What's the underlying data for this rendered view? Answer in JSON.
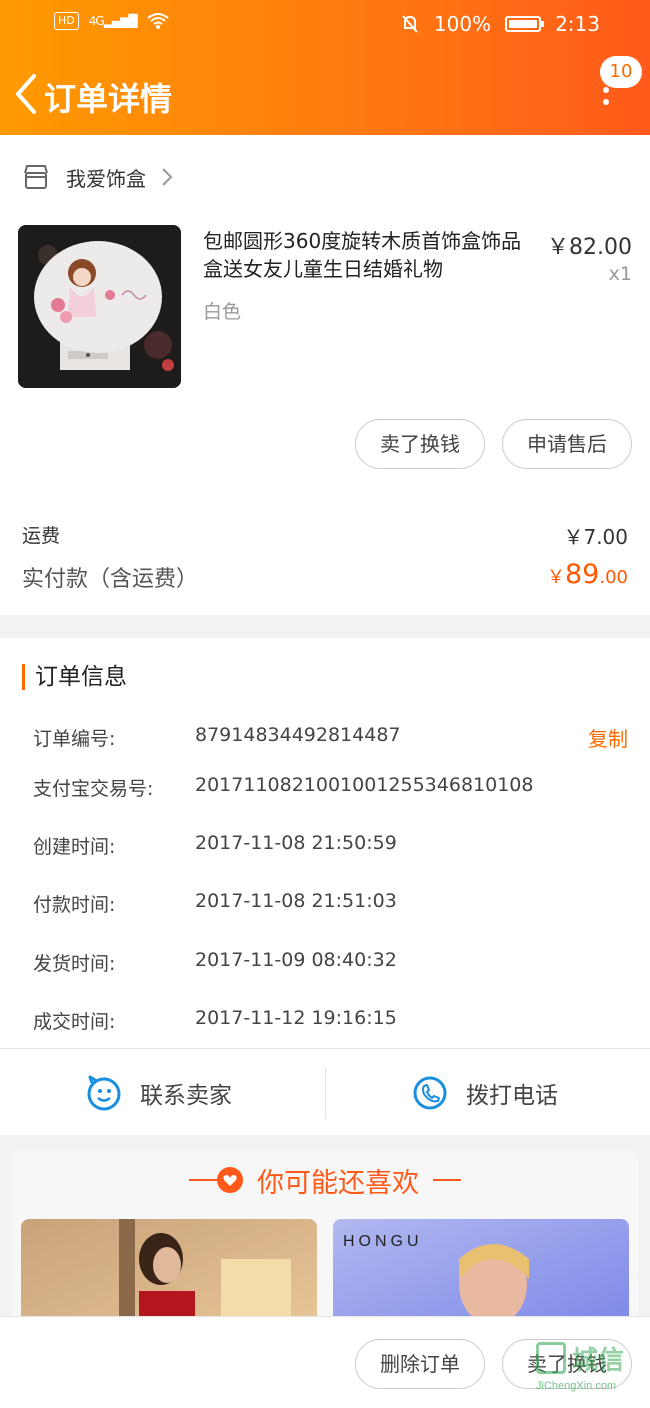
{
  "status_bar": {
    "hd": "HD",
    "network": "4G",
    "battery_percent": "100%",
    "battery_level": 1.0,
    "time": "2:13"
  },
  "nav": {
    "title": "订单详情",
    "notification_count": "10"
  },
  "shop": {
    "name": "我爱饰盒"
  },
  "product": {
    "title": "包邮圆形360度旋转木质首饰盒饰品盒送女友儿童生日结婚礼物",
    "variant": "白色",
    "price": "￥82.00",
    "quantity": "x1"
  },
  "item_actions": {
    "sell_label": "卖了换钱",
    "after_sale_label": "申请售后"
  },
  "summary": {
    "shipping_label": "运费",
    "shipping_value": "￥7.00",
    "paid_label": "实付款（含运费）",
    "paid_currency": "￥",
    "paid_integer": "89",
    "paid_decimal": ".00"
  },
  "order_info": {
    "section_title": "订单信息",
    "copy_label": "复制",
    "rows": [
      {
        "key": "订单编号:",
        "value": "87914834492814487"
      },
      {
        "key": "支付宝交易号:",
        "value": "20171108210010012553468101​08"
      },
      {
        "key": "创建时间:",
        "value": "2017-11-08 21:50:59"
      },
      {
        "key": "付款时间:",
        "value": "2017-11-08 21:51:03"
      },
      {
        "key": "发货时间:",
        "value": "2017-11-09 08:40:32"
      },
      {
        "key": "成交时间:",
        "value": "2017-11-12 19:16:15"
      }
    ]
  },
  "contact": {
    "seller_label": "联系卖家",
    "call_label": "拨打电话"
  },
  "recommend": {
    "title": "你可能还喜欢",
    "cards": [
      {
        "brand": ""
      },
      {
        "brand": "HONGU"
      }
    ]
  },
  "bottom_actions": {
    "delete_label": "删除订单",
    "sell_label": "卖了换钱"
  },
  "watermark": {
    "text": "城信",
    "url": "JiChengXin.com"
  },
  "colors": {
    "accent": "#ff6a00",
    "header_start": "#ff9a00",
    "header_end": "#ff5a1a",
    "link_blue": "#1a8fe0"
  }
}
